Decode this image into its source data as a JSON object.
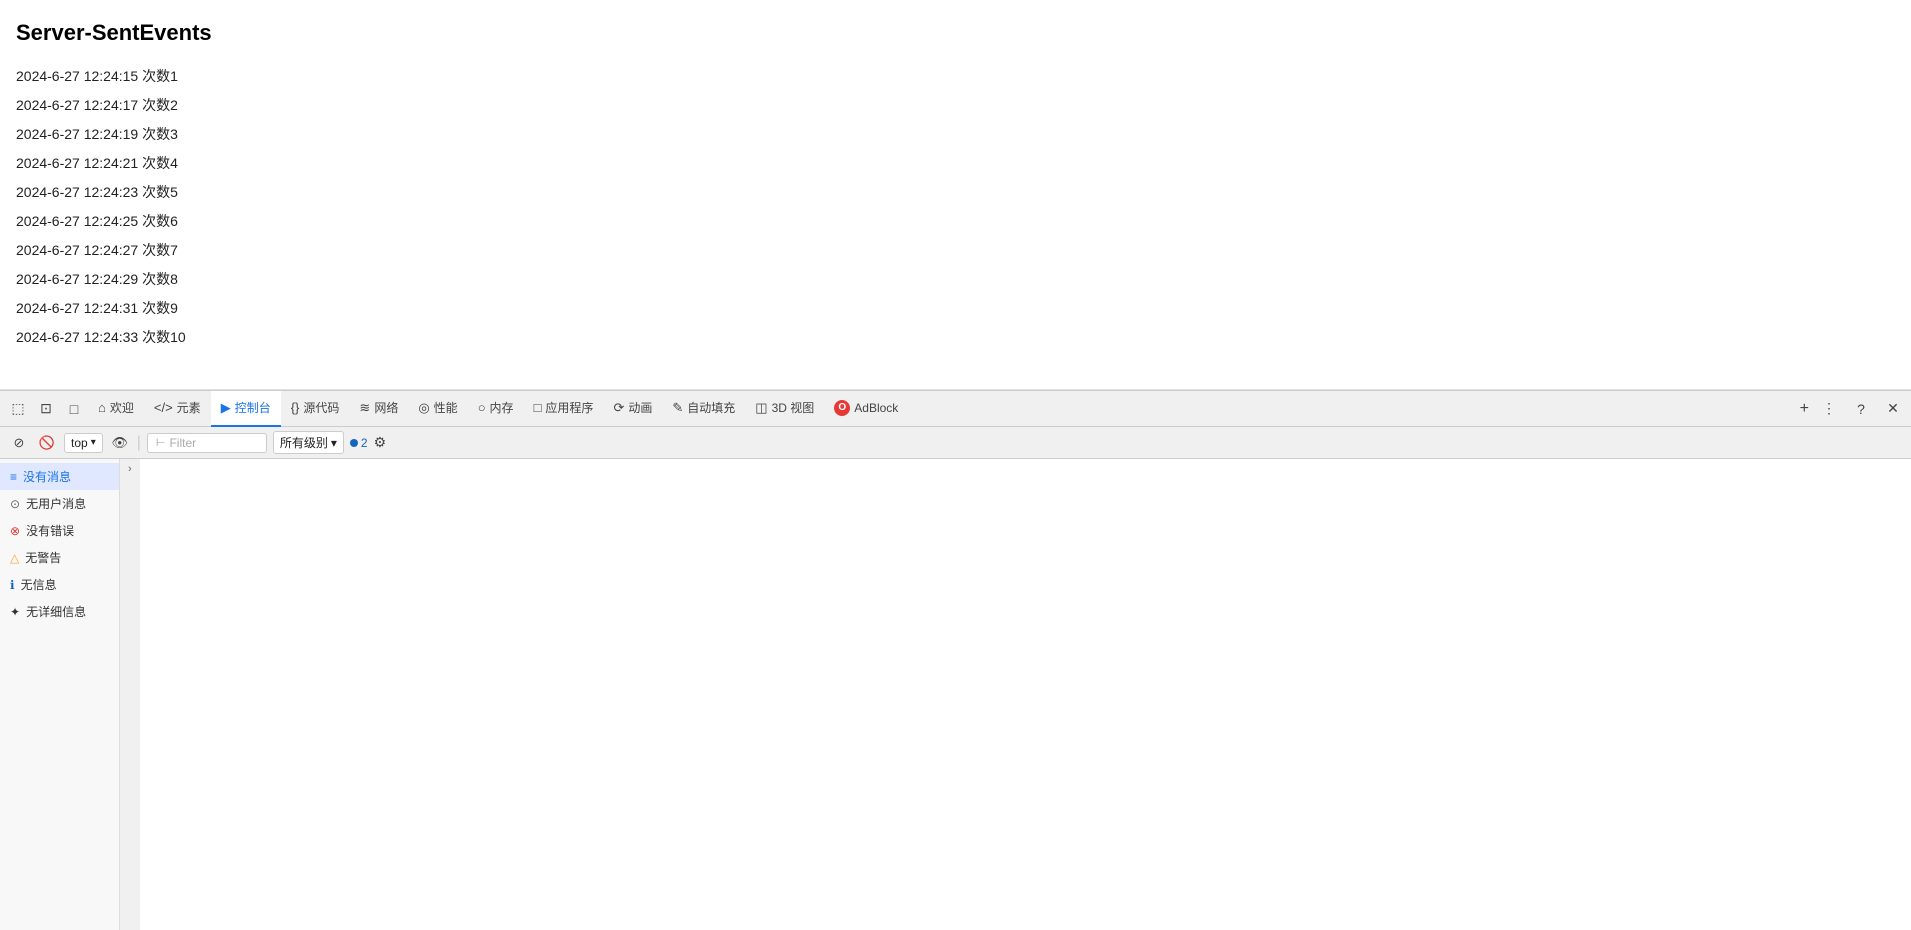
{
  "page": {
    "title": "Server-SentEvents",
    "events": [
      {
        "timestamp": "2024-6-27 12:24:15",
        "label": "次数1"
      },
      {
        "timestamp": "2024-6-27 12:24:17",
        "label": "次数2"
      },
      {
        "timestamp": "2024-6-27 12:24:19",
        "label": "次数3"
      },
      {
        "timestamp": "2024-6-27 12:24:21",
        "label": "次数4"
      },
      {
        "timestamp": "2024-6-27 12:24:23",
        "label": "次数5"
      },
      {
        "timestamp": "2024-6-27 12:24:25",
        "label": "次数6"
      },
      {
        "timestamp": "2024-6-27 12:24:27",
        "label": "次数7"
      },
      {
        "timestamp": "2024-6-27 12:24:29",
        "label": "次数8"
      },
      {
        "timestamp": "2024-6-27 12:24:31",
        "label": "次数9"
      },
      {
        "timestamp": "2024-6-27 12:24:33",
        "label": "次数10"
      }
    ]
  },
  "devtools": {
    "tabs": [
      {
        "id": "welcome",
        "label": "欢迎",
        "icon": "⌂",
        "active": false
      },
      {
        "id": "elements",
        "label": "元素",
        "icon": "</>",
        "active": false
      },
      {
        "id": "console",
        "label": "控制台",
        "icon": "▶",
        "active": true
      },
      {
        "id": "sources",
        "label": "源代码",
        "icon": "{ }",
        "active": false
      },
      {
        "id": "network",
        "label": "网络",
        "icon": "≋",
        "active": false
      },
      {
        "id": "performance",
        "label": "性能",
        "icon": "◎",
        "active": false
      },
      {
        "id": "memory",
        "label": "内存",
        "icon": "○",
        "active": false
      },
      {
        "id": "application",
        "label": "应用程序",
        "icon": "□",
        "active": false
      },
      {
        "id": "animation",
        "label": "动画",
        "icon": "⟳",
        "active": false
      },
      {
        "id": "autofill",
        "label": "自动填充",
        "icon": "✎",
        "active": false
      },
      {
        "id": "3dview",
        "label": "3D 视图",
        "icon": "◫",
        "active": false
      },
      {
        "id": "adblock",
        "label": "AdBlock",
        "icon": "●",
        "active": false
      }
    ],
    "toolbar": {
      "context": "top",
      "filter_placeholder": "Filter",
      "level": "所有级别",
      "badge_count": "2"
    },
    "sidebar": {
      "items": [
        {
          "id": "messages",
          "label": "没有消息",
          "icon": "≡",
          "active": true
        },
        {
          "id": "user",
          "label": "无用户消息",
          "icon": "⊙",
          "active": false
        },
        {
          "id": "errors",
          "label": "没有错误",
          "icon": "⊗",
          "color": "red",
          "active": false
        },
        {
          "id": "warnings",
          "label": "无警告",
          "icon": "△",
          "color": "orange",
          "active": false
        },
        {
          "id": "info",
          "label": "无信息",
          "icon": "ℹ",
          "color": "blue",
          "active": false
        },
        {
          "id": "verbose",
          "label": "无详细信息",
          "icon": "✦",
          "active": false
        }
      ]
    }
  }
}
